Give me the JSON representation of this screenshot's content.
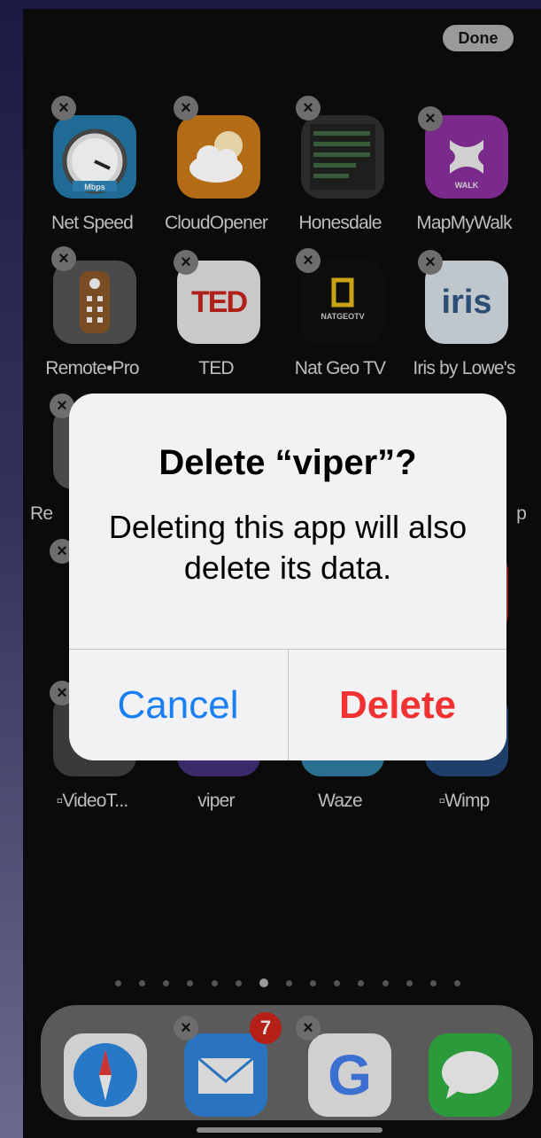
{
  "home": {
    "done_label": "Done",
    "apps": [
      {
        "label": "Net Speed",
        "icon": "speedometer-icon"
      },
      {
        "label": "CloudOpener",
        "icon": "cloud-sun-icon"
      },
      {
        "label": "Honesdale",
        "icon": "list-widget-icon"
      },
      {
        "label": "MapMyWalk",
        "icon": "under-armour-icon"
      },
      {
        "label": "Remote•Pro",
        "icon": "remote-control-icon"
      },
      {
        "label": "TED",
        "icon": "ted-logo-icon",
        "text": "TED"
      },
      {
        "label": "Nat Geo TV",
        "icon": "nat-geo-icon",
        "text": "NATGEOTV"
      },
      {
        "label": "Iris by Lowe's",
        "icon": "iris-house-icon",
        "text": "iris"
      },
      {
        "label": "Re",
        "icon": "app-icon"
      },
      {
        "label": "p",
        "icon": "app-icon"
      },
      {
        "label": "▫VideoT...",
        "icon": "video-app-icon"
      },
      {
        "label": "viper",
        "icon": "viper-icon"
      },
      {
        "label": "Waze",
        "icon": "waze-icon"
      },
      {
        "label": "▫Wimp",
        "icon": "wimp-icon"
      }
    ],
    "page_dots": 15,
    "active_dot": 6,
    "speed_sublabel": "Mbps",
    "walk_sublabel": "WALK"
  },
  "dock": {
    "apps": [
      {
        "name": "Safari",
        "icon": "compass-icon"
      },
      {
        "name": "Mail",
        "icon": "envelope-icon",
        "badge": "7"
      },
      {
        "name": "Google",
        "icon": "google-g-icon",
        "letter": "G"
      },
      {
        "name": "Messages",
        "icon": "speech-bubble-icon"
      }
    ]
  },
  "alert": {
    "title": "Delete “viper”?",
    "message": "Deleting this app will also delete its data.",
    "cancel_label": "Cancel",
    "delete_label": "Delete"
  },
  "colors": {
    "cancel": "#1a7ff5",
    "delete": "#f03232"
  }
}
